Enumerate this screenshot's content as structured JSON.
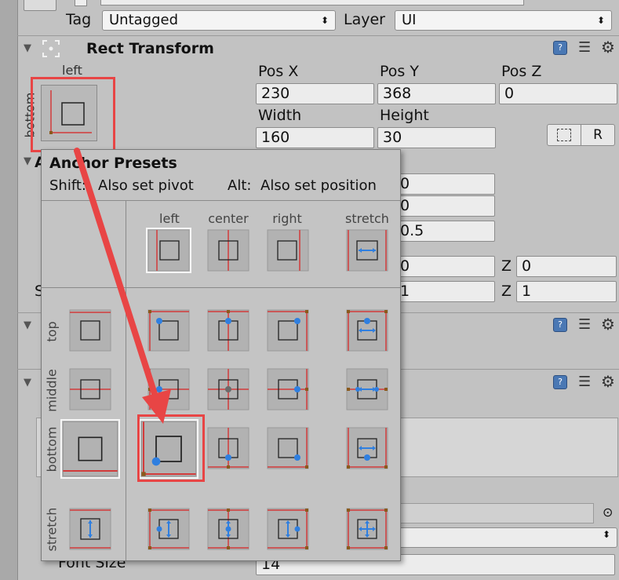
{
  "object_header": {
    "tag_label": "Tag",
    "tag_value": "Untagged",
    "layer_label": "Layer",
    "layer_value": "UI"
  },
  "rect_transform": {
    "title": "Rect Transform",
    "anchor_h_label": "left",
    "anchor_v_label": "bottom",
    "pos_x_label": "Pos X",
    "pos_y_label": "Pos Y",
    "pos_z_label": "Pos Z",
    "pos_x": "230",
    "pos_y": "368",
    "pos_z": "0",
    "width_label": "Width",
    "height_label": "Height",
    "width": "160",
    "height": "30",
    "raw_edit_button": "R",
    "pivot_x": "0",
    "pivot_y": "0",
    "pivot_extra": "0.5",
    "rotation_z_label": "Z",
    "rotation_x": "0",
    "rotation_z": "0",
    "scale_z_label": "Z",
    "scale_x": "1",
    "scale_z": "1",
    "partial_label_a": "A",
    "partial_label_s": "S"
  },
  "text_component": {
    "font_size_label": "Font Size",
    "font_size_value": "14"
  },
  "anchor_presets": {
    "title": "Anchor Presets",
    "shift_key": "Shift:",
    "shift_text": "Also set pivot",
    "alt_key": "Alt:",
    "alt_text": "Also set position",
    "columns": [
      "left",
      "center",
      "right",
      "stretch"
    ],
    "rows": [
      "top",
      "middle",
      "bottom",
      "stretch"
    ],
    "selected": "bottom-left"
  },
  "colors": {
    "anchor_red": "#d23b3b",
    "handle_blue": "#2f7fe0",
    "corner_brown": "#8a5a1c",
    "highlight_red": "#e84545",
    "popup_bg": "#c4c4c4",
    "component_icon_blue": "#4a78b4"
  },
  "icons": [
    "rect-transform-icon",
    "book-icon",
    "sliders-icon",
    "gear-icon",
    "dropdown-arrow-icon",
    "target-icon",
    "blueprint-icon"
  ]
}
